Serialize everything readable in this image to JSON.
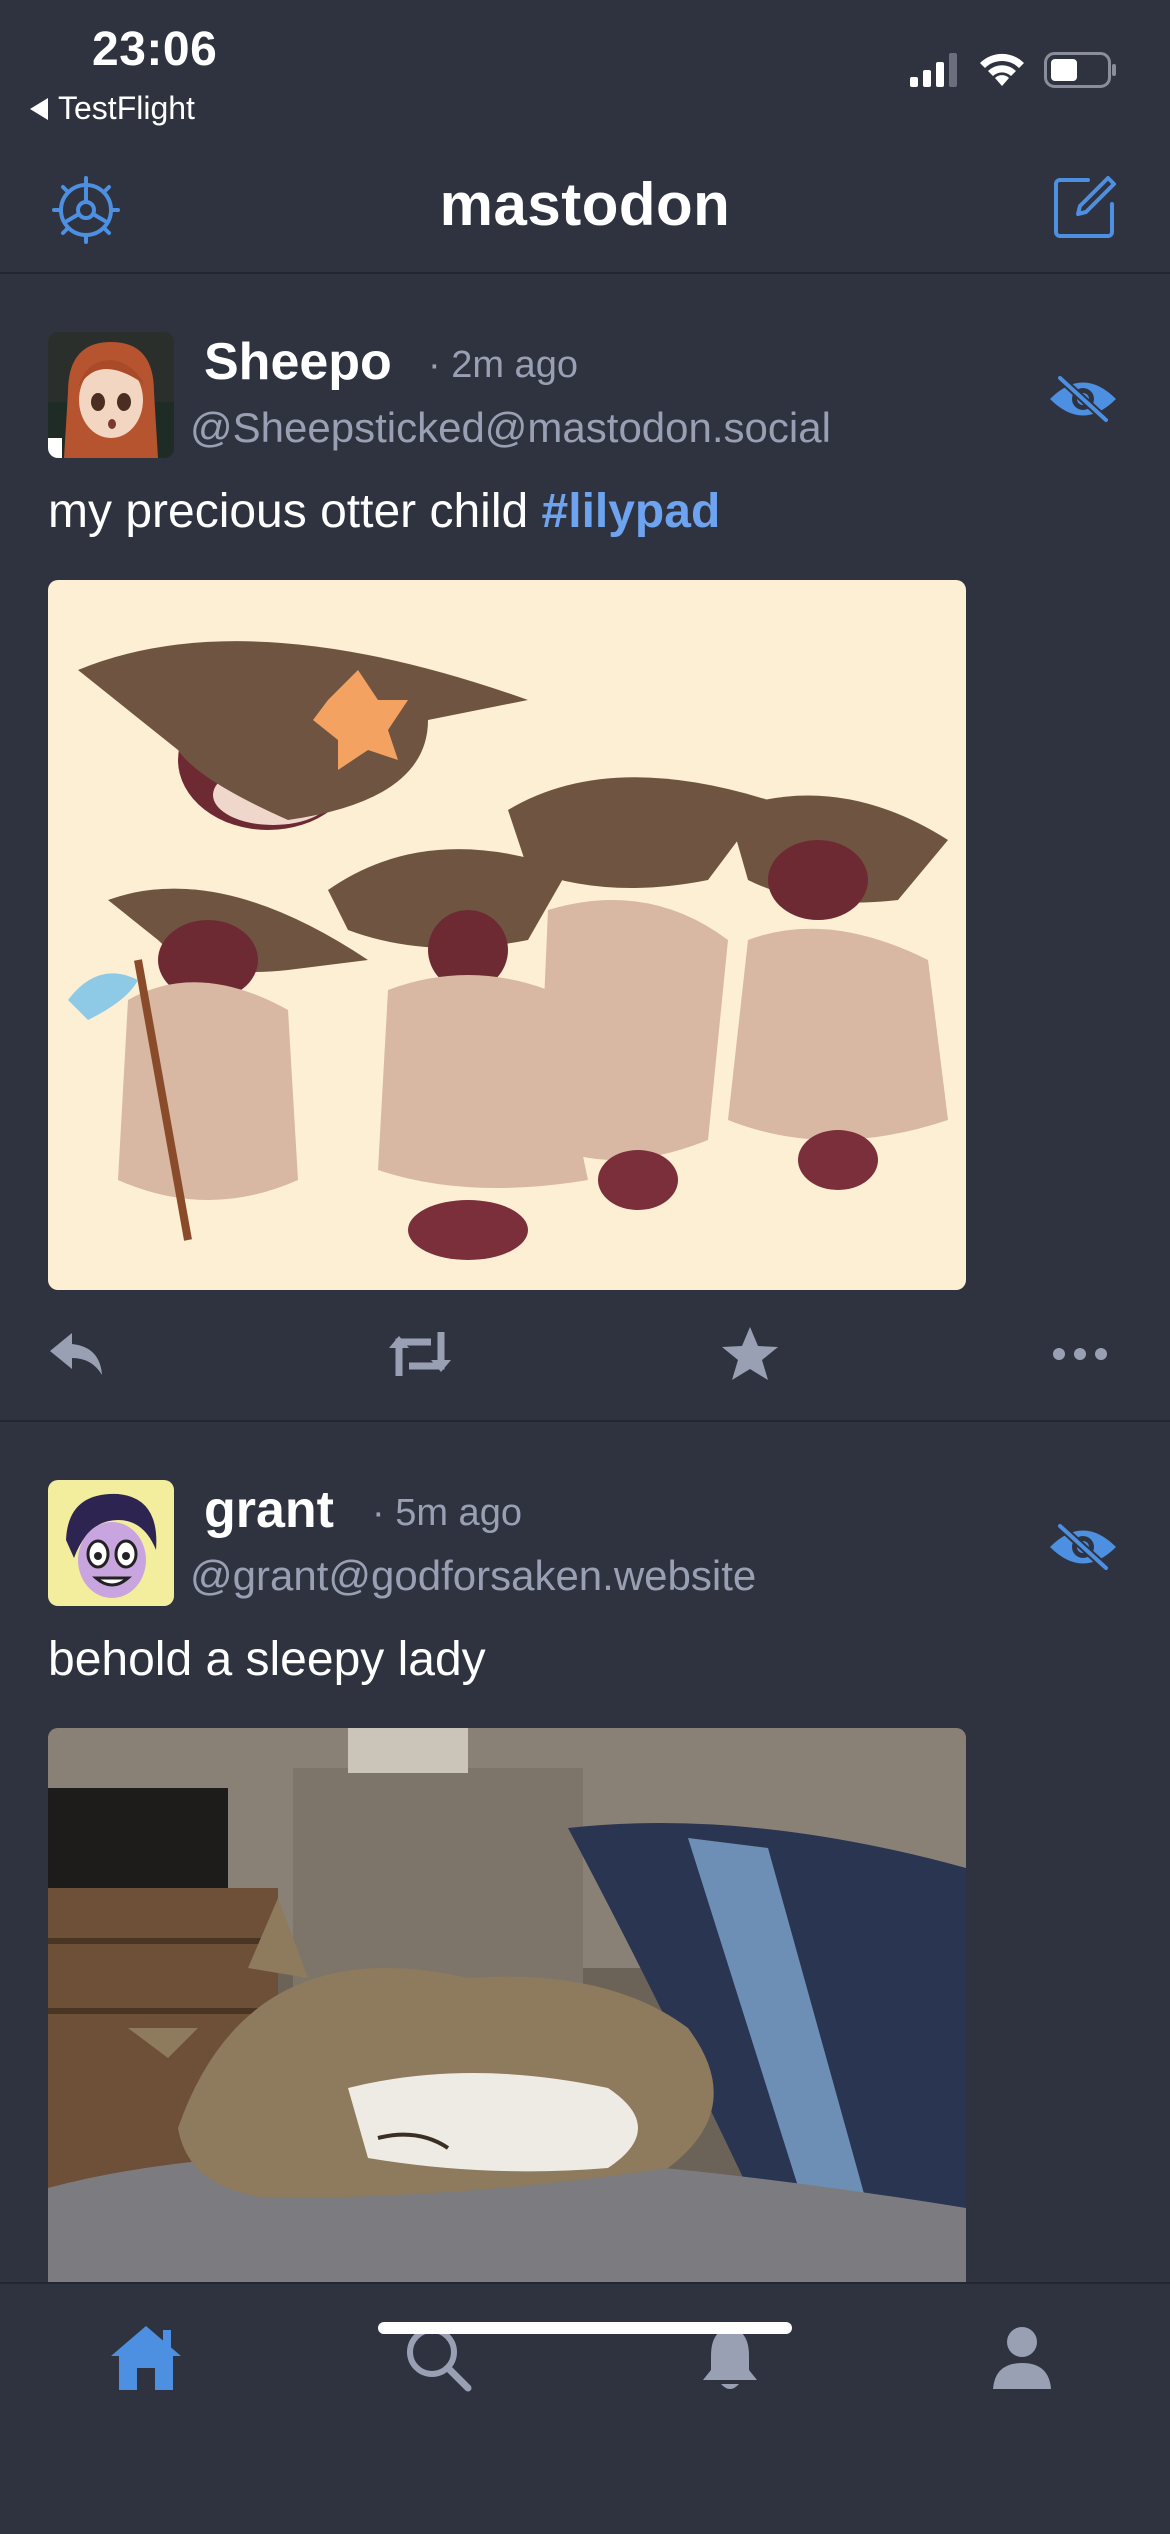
{
  "status_bar": {
    "time": "23:06",
    "back_label": "TestFlight"
  },
  "nav": {
    "title": "mastodon",
    "settings_icon": "gear-icon",
    "compose_icon": "compose-icon"
  },
  "posts": [
    {
      "display_name": "Sheepo",
      "time": "· 2m ago",
      "handle": "@Sheepsticked@mastodon.social",
      "text": "my precious otter child ",
      "hashtag": "#lilypad",
      "media_description_icon": "image"
    },
    {
      "display_name": "grant",
      "time": "· 5m ago",
      "handle": "@grant@godforsaken.website",
      "text": "behold a sleepy lady",
      "hashtag": "",
      "media_description_icon": "image"
    }
  ],
  "actions": {
    "reply_icon": "reply-icon",
    "boost_icon": "boost-icon",
    "favorite_icon": "star-icon",
    "more_icon": "more-icon"
  },
  "tabs": [
    {
      "name": "home",
      "icon": "home-icon",
      "active": true
    },
    {
      "name": "search",
      "icon": "search-icon",
      "active": false
    },
    {
      "name": "notifications",
      "icon": "bell-icon",
      "active": false
    },
    {
      "name": "profile",
      "icon": "person-icon",
      "active": false
    }
  ],
  "colors": {
    "background": "#2f3340",
    "accent": "#4d8fe0",
    "hashtag": "#6ea4ef",
    "muted_text": "#9aa0b4",
    "icon_gray": "#9aa0b4",
    "divider": "#242733"
  }
}
